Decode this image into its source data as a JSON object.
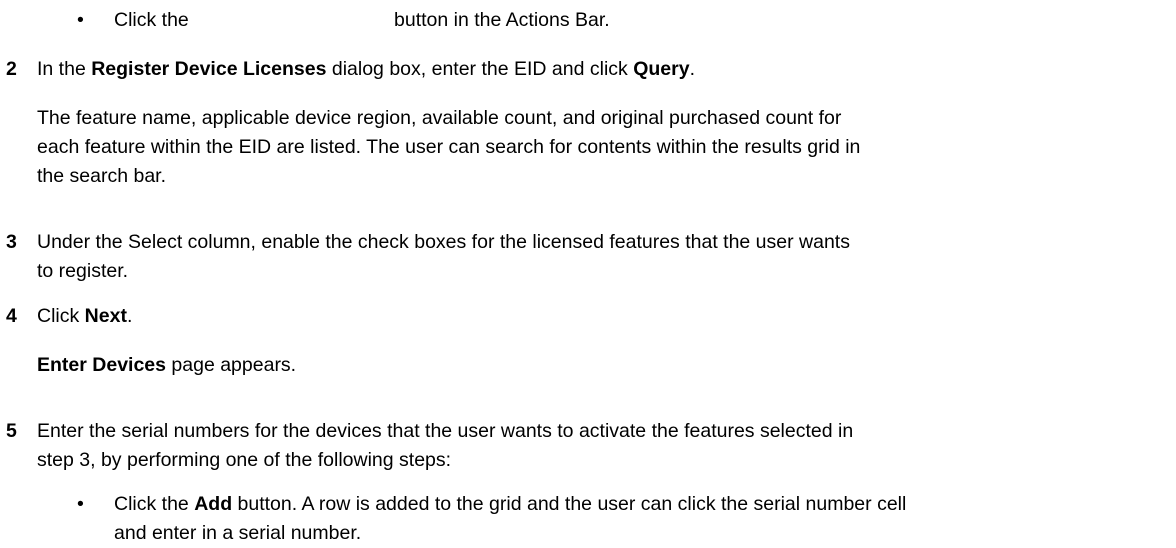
{
  "intro_bullet": {
    "bullet": "•",
    "before": "Click the",
    "after": "button in the Actions Bar."
  },
  "step2": {
    "number": "2",
    "pre": "In the ",
    "dialog": "Register Device Licenses",
    "mid": " dialog box, enter the EID and click ",
    "button": "Query",
    "end": "."
  },
  "step2_desc": {
    "line1": "The feature name, applicable device region, available count, and original purchased count for",
    "line2": "each feature within the EID are listed. The user can search for contents within the results grid in",
    "line3": "the search bar."
  },
  "step3": {
    "number": "3",
    "line1": "Under the Select column, enable the check boxes for the licensed features that the user wants",
    "line2": "to register."
  },
  "step4": {
    "number": "4",
    "pre": "Click ",
    "button": "Next",
    "end": "."
  },
  "step4_result": {
    "page": "Enter Devices",
    "rest": " page appears."
  },
  "step5": {
    "number": "5",
    "line1": "Enter the serial numbers for the devices that the user wants to activate the features selected in",
    "line2": "step 3, by performing one of the following steps:"
  },
  "step5_bullet": {
    "bullet": "•",
    "pre": "Click the ",
    "button": "Add",
    "line1_rest": " button. A row is added to the grid and the user can click the serial number cell",
    "line2": "and enter in a serial number."
  }
}
